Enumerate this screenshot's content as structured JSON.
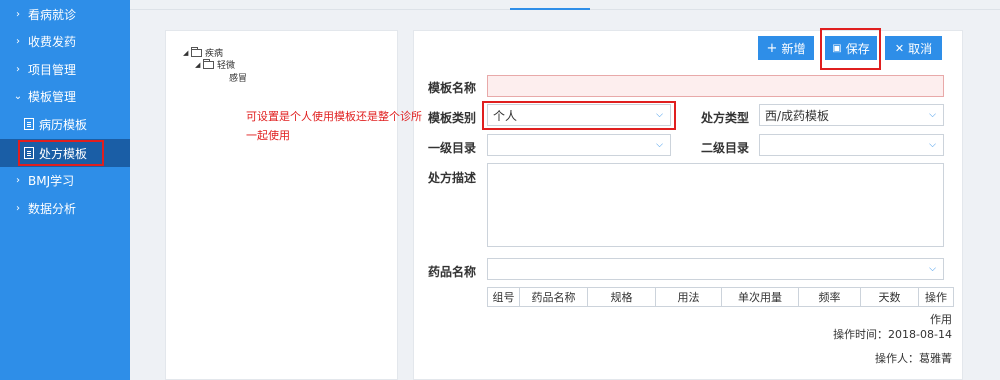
{
  "sidebar": {
    "items": [
      {
        "label": "看病就诊",
        "icon": "chevron-right-icon"
      },
      {
        "label": "收费发药",
        "icon": "chevron-right-icon"
      },
      {
        "label": "项目管理",
        "icon": "chevron-right-icon"
      },
      {
        "label": "模板管理",
        "icon": "chevron-down-icon"
      },
      {
        "label": "BMJ学习",
        "icon": "chevron-right-icon"
      },
      {
        "label": "数据分析",
        "icon": "chevron-right-icon"
      }
    ],
    "sub_items": [
      {
        "label": "病历模板",
        "icon": "document-icon"
      },
      {
        "label": "处方模板",
        "icon": "document-icon",
        "active": true
      }
    ]
  },
  "tree": {
    "nodes": [
      {
        "label": "疾病",
        "level": 0
      },
      {
        "label": "轻微",
        "level": 1
      },
      {
        "label": "感冒",
        "level": 2
      }
    ]
  },
  "toolbar": {
    "add_label": "新增",
    "save_label": "保存",
    "cancel_label": "取消"
  },
  "form": {
    "template_name_label": "模板名称",
    "template_name_value": "",
    "template_type_label": "模板类别",
    "template_type_value": "个人",
    "rx_type_label": "处方类型",
    "rx_type_value": "西/成药模板",
    "level1_label": "一级目录",
    "level1_value": "",
    "level2_label": "二级目录",
    "level2_value": "",
    "description_label": "处方描述",
    "drug_name_label": "药品名称",
    "drug_name_value": ""
  },
  "annotation": "可设置是个人使用模板还是整个诊所一起使用",
  "drug_table": {
    "columns": [
      "组号",
      "药品名称",
      "规格",
      "用法",
      "单次用量",
      "频率",
      "天数",
      "操作"
    ],
    "delete_label": "作用"
  },
  "meta": {
    "time": "操作时间：2018-08-14",
    "operator": "操作人：葛雅菁"
  },
  "colors": {
    "sidebar": "#2e8ee8",
    "active": "#1a5ea6",
    "highlight": "#e01f1f"
  }
}
